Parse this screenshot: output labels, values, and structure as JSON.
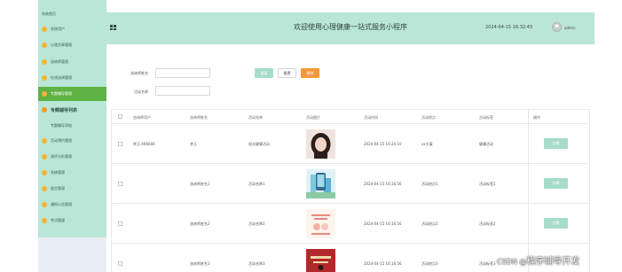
{
  "sidebar": {
    "items": [
      {
        "label": "系统首页",
        "type": "sub-top"
      },
      {
        "label": "系统用户",
        "type": "normal"
      },
      {
        "label": "心理文章管理",
        "type": "normal"
      },
      {
        "label": "咨询师管理",
        "type": "normal"
      },
      {
        "label": "在线咨询管理",
        "type": "normal"
      },
      {
        "label": "专题辅导管理",
        "type": "active"
      },
      {
        "label": "专题辅导列表",
        "type": "expanded"
      },
      {
        "label": "专题辅导添加",
        "type": "sub"
      },
      {
        "label": "活动预约管理",
        "type": "normal"
      },
      {
        "label": "测评分析管理",
        "type": "normal"
      },
      {
        "label": "系统管理",
        "type": "normal"
      },
      {
        "label": "留言管理",
        "type": "normal"
      },
      {
        "label": "通知公告管理",
        "type": "normal"
      },
      {
        "label": "考试管理",
        "type": "normal"
      }
    ]
  },
  "header": {
    "title": "欢迎使用心理健康一站式服务小程序",
    "datetime": "2024-04-15 16:32:43",
    "username": "admin"
  },
  "search": {
    "field1_label": "咨询师姓名",
    "field2_label": "活动名称",
    "field1_value": "",
    "field2_value": "",
    "search_btn": "搜索",
    "add_btn": "重置",
    "delete_btn": "删除"
  },
  "table": {
    "headers": [
      "咨询师用户",
      "咨询师姓名",
      "活动名称",
      "活动图片",
      "活动时间",
      "活动地点",
      "活动标签",
      "操作"
    ],
    "rows": [
      {
        "user": "李玉.466666",
        "name": "李玉",
        "activity": "阳光健康活动",
        "time": "2024-04-15 16:24:10",
        "place": "xx大厦",
        "tag": "健康活动",
        "action": "详情"
      },
      {
        "user": "",
        "name": "咨询师姓名1",
        "activity": "活动名称1",
        "time": "2024-04-15 16:16:56",
        "place": "活动地点1",
        "tag": "活动标签1",
        "action": "详情"
      },
      {
        "user": "",
        "name": "咨询师姓名2",
        "activity": "活动名称2",
        "time": "2024-04-15 16:16:56",
        "place": "活动地点2",
        "tag": "活动标签2",
        "action": "详情"
      },
      {
        "user": "",
        "name": "咨询师姓名3",
        "activity": "活动名称3",
        "time": "2024-04-15 16:16:56",
        "place": "活动地点3",
        "tag": "活动标签3",
        "action": "详情"
      }
    ]
  },
  "watermark": {
    "text_prefix": "CSDN @",
    "text_main": "程序辅导开发"
  },
  "colors": {
    "mint": "#b9e6d6",
    "active_green": "#5fb244",
    "button_mint": "#a6dcc9",
    "orange": "#f5983b"
  }
}
